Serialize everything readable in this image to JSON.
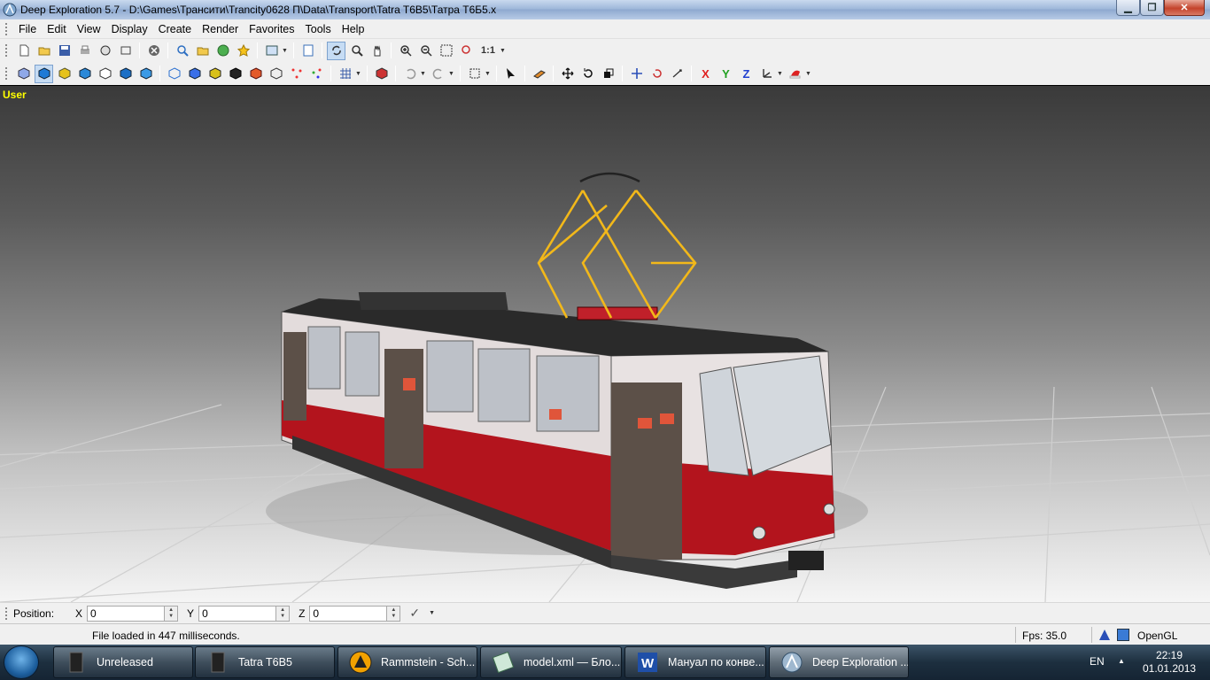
{
  "window": {
    "title": "Deep Exploration 5.7 - D:\\Games\\Трансити\\Trancity0628 П\\Data\\Transport\\Tatra T6B5\\Татра T6Б5.x",
    "buttons": {
      "minimize": "▁",
      "maximize": "❐",
      "close": "✕"
    }
  },
  "menubar": {
    "items": [
      "File",
      "Edit",
      "View",
      "Display",
      "Create",
      "Render",
      "Favorites",
      "Tools",
      "Help"
    ]
  },
  "toolbar2": {
    "axis_x": "X",
    "axis_y": "Y",
    "axis_z": "Z",
    "zoom_ratio": "1:1"
  },
  "viewport": {
    "label": "User"
  },
  "position_bar": {
    "label": "Position:",
    "x_label": "X",
    "x_value": "0",
    "y_label": "Y",
    "y_value": "0",
    "z_label": "Z",
    "z_value": "0"
  },
  "statusbar": {
    "message": "File loaded in 447 milliseconds.",
    "fps": "Fps: 35.0",
    "renderer": "OpenGL"
  },
  "taskbar": {
    "tasks": [
      {
        "label": "Unreleased",
        "icon": "folder-icon",
        "active": false
      },
      {
        "label": "Tatra T6B5",
        "icon": "folder-icon",
        "active": false
      },
      {
        "label": "Rammstein - Sch...",
        "icon": "aimp-player-icon",
        "active": false
      },
      {
        "label": "model.xml — Бло...",
        "icon": "notepad-icon",
        "active": false
      },
      {
        "label": "Мануал по конве...",
        "icon": "word-icon",
        "active": false
      },
      {
        "label": "Deep Exploration ...",
        "icon": "deep-exploration-icon",
        "active": true
      }
    ],
    "language": "EN",
    "time": "22:19",
    "date": "01.01.2013"
  },
  "colors": {
    "viewport_label": "#ffff00",
    "tram_red": "#b3141d",
    "tram_body": "#e5dede",
    "pantograph": "#f2b81a"
  }
}
